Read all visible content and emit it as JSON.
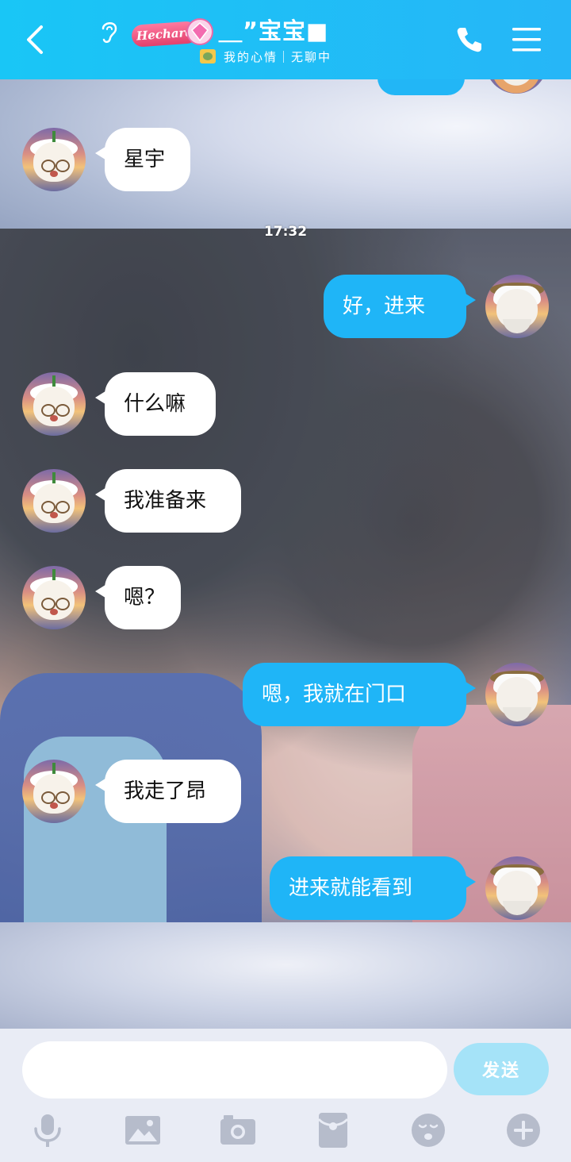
{
  "header": {
    "title": "＿”宝宝■",
    "badge": "Hechare",
    "subtitle": "我的心情｜无聊中",
    "colors": {
      "bar": "#1fb5f7",
      "icon": "#ffffff"
    }
  },
  "timestamp": "17:32",
  "messages": [
    {
      "side": "left",
      "text": "星宇"
    },
    {
      "side": "right",
      "text": "好，进来"
    },
    {
      "side": "left",
      "text": "什么嘛"
    },
    {
      "side": "left",
      "text": "我准备来"
    },
    {
      "side": "left",
      "text": "嗯？"
    },
    {
      "side": "right",
      "text": "嗯，我就在门口"
    },
    {
      "side": "left",
      "text": "我走了昂"
    },
    {
      "side": "right",
      "text": "进来就能看到"
    }
  ],
  "input": {
    "value": "",
    "send_label": "发送"
  },
  "toolbar": [
    "microphone-icon",
    "image-icon",
    "camera-icon",
    "red-packet-icon",
    "emoji-icon",
    "plus-icon"
  ]
}
